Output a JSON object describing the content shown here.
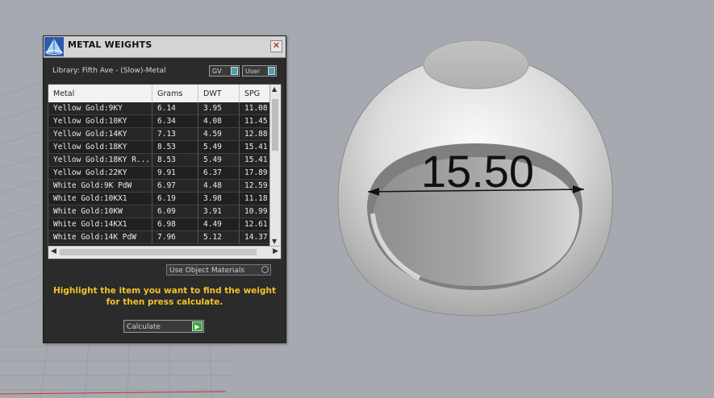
{
  "window": {
    "title": "METAL WEIGHTS",
    "close_icon": "close-icon",
    "logo_icon": "pyramid-logo-icon"
  },
  "library_label": "Library: Fifth Ave - (Slow)-Metal",
  "toggles": {
    "gv": "GV",
    "user": "User"
  },
  "table": {
    "headers": [
      "Metal",
      "Grams",
      "DWT",
      "SPG"
    ],
    "rows": [
      [
        "Yellow Gold:9KY",
        "6.14",
        "3.95",
        "11.08"
      ],
      [
        "Yellow Gold:10KY",
        "6.34",
        "4.08",
        "11.45"
      ],
      [
        "Yellow Gold:14KY",
        "7.13",
        "4.59",
        "12.88"
      ],
      [
        "Yellow Gold:18KY",
        "8.53",
        "5.49",
        "15.41"
      ],
      [
        "Yellow Gold:18KY R...",
        "8.53",
        "5.49",
        "15.41"
      ],
      [
        "Yellow Gold:22KY",
        "9.91",
        "6.37",
        "17.89"
      ],
      [
        "White Gold:9K PdW",
        "6.97",
        "4.48",
        "12.59"
      ],
      [
        "White Gold:10KX1",
        "6.19",
        "3.98",
        "11.18"
      ],
      [
        "White Gold:10KW",
        "6.09",
        "3.91",
        "10.99"
      ],
      [
        "White Gold:14KX1",
        "6.98",
        "4.49",
        "12.61"
      ],
      [
        "White Gold:14K PdW",
        "7.96",
        "5.12",
        "14.37"
      ]
    ]
  },
  "object_materials": "Use Object Materials",
  "hint_line1": "Highlight the item you want to find the weight",
  "hint_line2": "for then press calculate.",
  "calculate_label": "Calculate",
  "dimension_label": "15.50",
  "colors": {
    "viewport": "#a6aab0",
    "panel": "#2b2b2b",
    "hint": "#f3c228",
    "accent_toggle": "#4fa0a8",
    "go_button": "#3aa83a"
  }
}
